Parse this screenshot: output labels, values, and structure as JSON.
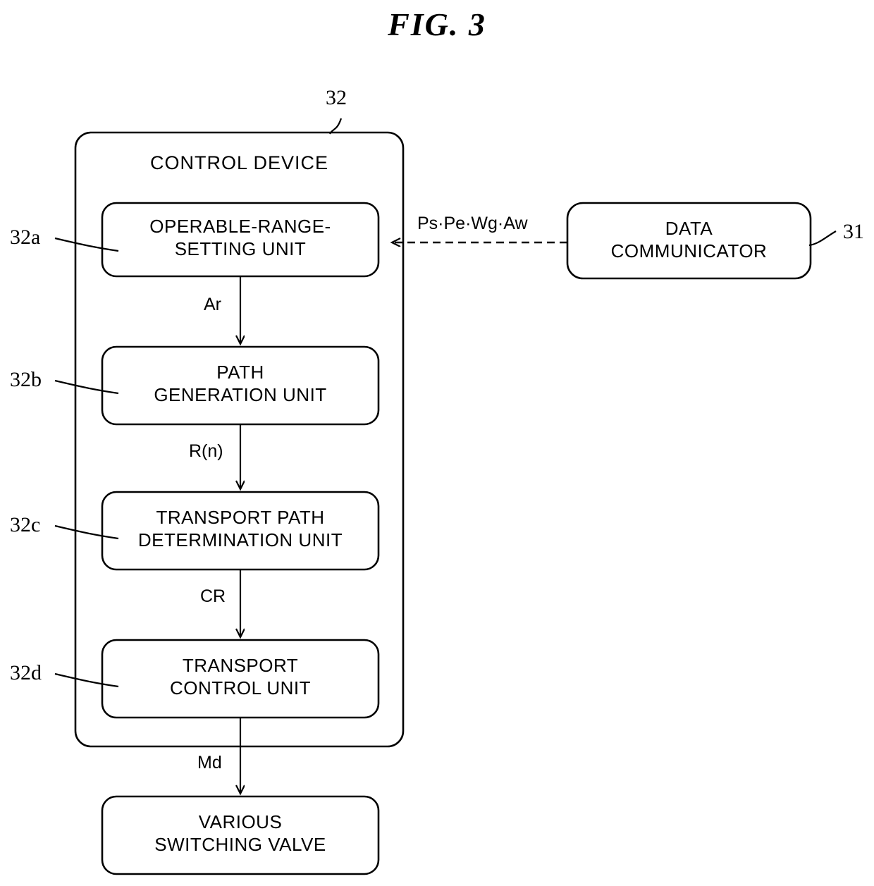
{
  "figure": {
    "title": "FIG. 3"
  },
  "control_device": {
    "title": "CONTROL DEVICE",
    "ref": "32",
    "units": [
      {
        "ref": "32a",
        "label": "OPERABLE-RANGE-\nSETTING UNIT"
      },
      {
        "ref": "32b",
        "label": "PATH\nGENERATION UNIT"
      },
      {
        "ref": "32c",
        "label": "TRANSPORT PATH\nDETERMINATION UNIT"
      },
      {
        "ref": "32d",
        "label": "TRANSPORT\nCONTROL UNIT"
      }
    ]
  },
  "external": {
    "data_communicator": {
      "label": "DATA\nCOMMUNICATOR",
      "ref": "31"
    },
    "switching_valve": {
      "label": "VARIOUS\nSWITCHING VALVE"
    }
  },
  "signals": {
    "input": "Ps·Pe·Wg·Aw",
    "a_to_b": "Ar",
    "b_to_c": "R(n)",
    "c_to_d": "CR",
    "d_to_valve": "Md"
  },
  "colors": {
    "stroke": "#000000",
    "background": "#ffffff"
  }
}
